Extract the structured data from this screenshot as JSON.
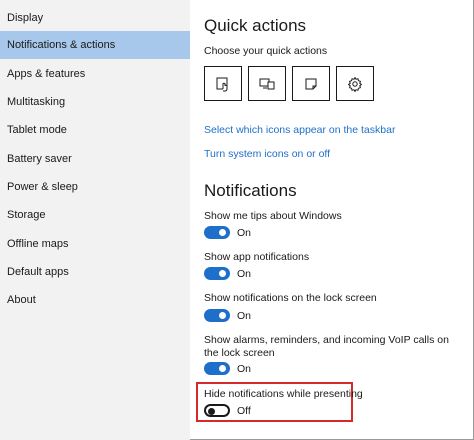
{
  "sidebar": {
    "items": [
      {
        "label": "Display"
      },
      {
        "label": "Notifications & actions",
        "selected": true
      },
      {
        "label": "Apps & features"
      },
      {
        "label": "Multitasking"
      },
      {
        "label": "Tablet mode"
      },
      {
        "label": "Battery saver"
      },
      {
        "label": "Power & sleep"
      },
      {
        "label": "Storage"
      },
      {
        "label": "Offline maps"
      },
      {
        "label": "Default apps"
      },
      {
        "label": "About"
      }
    ]
  },
  "quick_actions": {
    "title": "Quick actions",
    "subtitle": "Choose your quick actions",
    "tiles": [
      "tablet-mode-icon",
      "project-icon",
      "note-icon",
      "settings-gear-icon"
    ],
    "link_taskbar": "Select which icons appear on the taskbar",
    "link_system_icons": "Turn system icons on or off"
  },
  "notifications": {
    "title": "Notifications",
    "settings": [
      {
        "label": "Show me tips about Windows",
        "state": "On"
      },
      {
        "label": "Show app notifications",
        "state": "On"
      },
      {
        "label": "Show notifications on the lock screen",
        "state": "On"
      },
      {
        "label": "Show alarms, reminders, and incoming VoIP calls on the lock screen",
        "state": "On"
      },
      {
        "label": "Hide notifications while presenting",
        "state": "Off"
      }
    ]
  },
  "colors": {
    "accent": "#1e6fc9",
    "selected_nav": "#a7c8ea",
    "highlight_box": "#d42a2a"
  }
}
